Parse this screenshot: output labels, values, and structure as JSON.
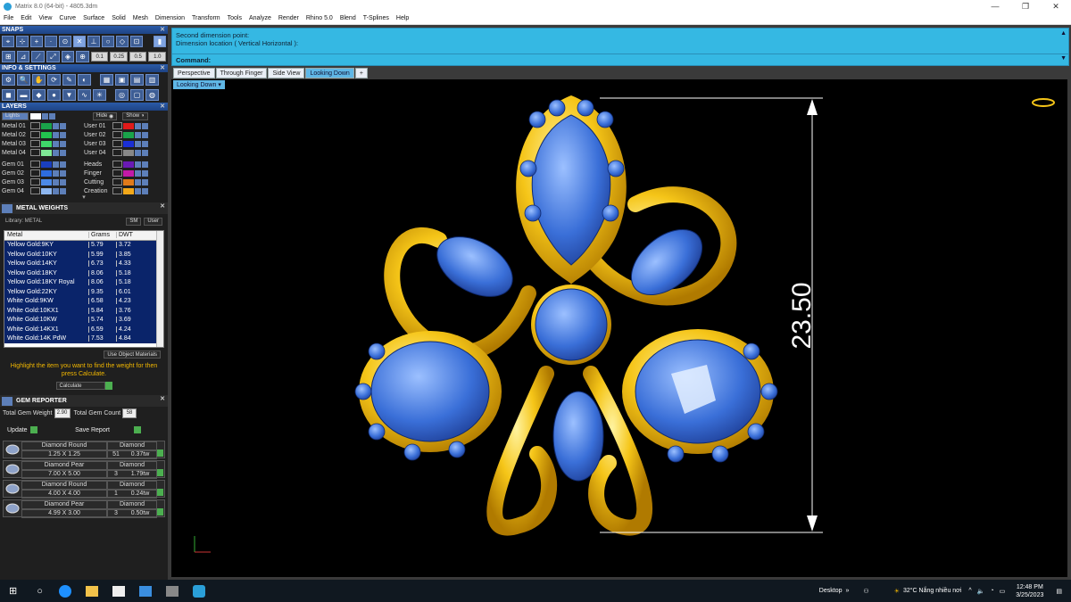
{
  "window": {
    "title": "Matrix 8.0 (64-bit) - 4805.3dm",
    "min": "—",
    "max": "❐",
    "close": "✕"
  },
  "menu": [
    "File",
    "Edit",
    "View",
    "Curve",
    "Surface",
    "Solid",
    "Mesh",
    "Dimension",
    "Transform",
    "Tools",
    "Analyze",
    "Render",
    "Rhino 5.0",
    "Blend",
    "T-Splines",
    "Help"
  ],
  "snaps": {
    "title": "SNAPS",
    "values": [
      "0.1",
      "0.25",
      "0.5",
      "1.0"
    ]
  },
  "info": {
    "title": "INFO & SETTINGS"
  },
  "layers": {
    "title": "LAYERS",
    "lights_label": "Lights",
    "hide_label": "Hide",
    "show_label": "Show",
    "left": [
      {
        "name": "Metal 01",
        "color": "#1aa34a"
      },
      {
        "name": "Metal 02",
        "color": "#22c24f"
      },
      {
        "name": "Metal 03",
        "color": "#3fd86a"
      },
      {
        "name": "Metal 04",
        "color": "#7fe896"
      },
      {
        "name": "Gem 01",
        "color": "#1a3fbf"
      },
      {
        "name": "Gem 02",
        "color": "#2e6de0"
      },
      {
        "name": "Gem 03",
        "color": "#4c8ae8"
      },
      {
        "name": "Gem 04",
        "color": "#8db6f0"
      }
    ],
    "right": [
      {
        "name": "User 01",
        "color": "#e01a1a"
      },
      {
        "name": "User 02",
        "color": "#1aa34a"
      },
      {
        "name": "User 03",
        "color": "#1a2fd6"
      },
      {
        "name": "User 04",
        "color": "#888888"
      },
      {
        "name": "Heads",
        "color": "#6a1ab5"
      },
      {
        "name": "Finger",
        "color": "#c21aa8"
      },
      {
        "name": "Cutting",
        "color": "#e07a1a"
      },
      {
        "name": "Creation",
        "color": "#f2a81a"
      }
    ]
  },
  "metal_weights": {
    "title": "METAL WEIGHTS",
    "library": "Library: METAL",
    "btn1": "SM",
    "btn2": "User",
    "headers": [
      "Metal",
      "Grams",
      "DWT"
    ],
    "rows": [
      [
        "Yellow Gold:9KY",
        "5.79",
        "3.72"
      ],
      [
        "Yellow Gold:10KY",
        "5.99",
        "3.85"
      ],
      [
        "Yellow Gold:14KY",
        "6.73",
        "4.33"
      ],
      [
        "Yellow Gold:18KY",
        "8.06",
        "5.18"
      ],
      [
        "Yellow Gold:18KY Royal",
        "8.06",
        "5.18"
      ],
      [
        "Yellow Gold:22KY",
        "9.35",
        "6.01"
      ],
      [
        "White Gold:9KW",
        "6.58",
        "4.23"
      ],
      [
        "White Gold:10KX1",
        "5.84",
        "3.76"
      ],
      [
        "White Gold:10KW",
        "5.74",
        "3.69"
      ],
      [
        "White Gold:14KX1",
        "6.59",
        "4.24"
      ],
      [
        "White Gold:14K PdW",
        "7.53",
        "4.84"
      ]
    ],
    "use_obj": "Use Object Materials",
    "help": "Highlight the item you want to find the weight for then press Calculate.",
    "calc": "Calculate"
  },
  "gem_reporter": {
    "title": "GEM REPORTER",
    "tgw_label": "Total Gem Weight",
    "tgw_value": "2.90",
    "tgc_label": "Total Gem Count",
    "tgc_value": "58",
    "update": "Update",
    "save": "Save Report",
    "gems": [
      {
        "shape": "Diamond Round",
        "size": "1.25 X 1.25",
        "count": "51",
        "type": "Diamond",
        "wt": "0.37tw"
      },
      {
        "shape": "Diamond Pear",
        "size": "7.00 X 5.00",
        "count": "3",
        "type": "Diamond",
        "wt": "1.79tw"
      },
      {
        "shape": "Diamond Round",
        "size": "4.00 X 4.00",
        "count": "1",
        "type": "Diamond",
        "wt": "0.24tw"
      },
      {
        "shape": "Diamond Pear",
        "size": "4.99 X 3.00",
        "count": "3",
        "type": "Diamond",
        "wt": "0.50tw"
      }
    ]
  },
  "command": {
    "line1": "Second dimension point:",
    "line2": "Dimension location ( Vertical  Horizontal ):",
    "label": "Command:"
  },
  "tabs": [
    "Perspective",
    "Through Finger",
    "Side View",
    "Looking Down"
  ],
  "active_tab": "Looking Down",
  "viewport": {
    "label": "Looking Down",
    "dimension": "23.50"
  },
  "taskbar": {
    "desktop": "Desktop",
    "weather": "32°C  Nắng nhiều nơi",
    "time": "12:48 PM",
    "date": "3/25/2023"
  }
}
